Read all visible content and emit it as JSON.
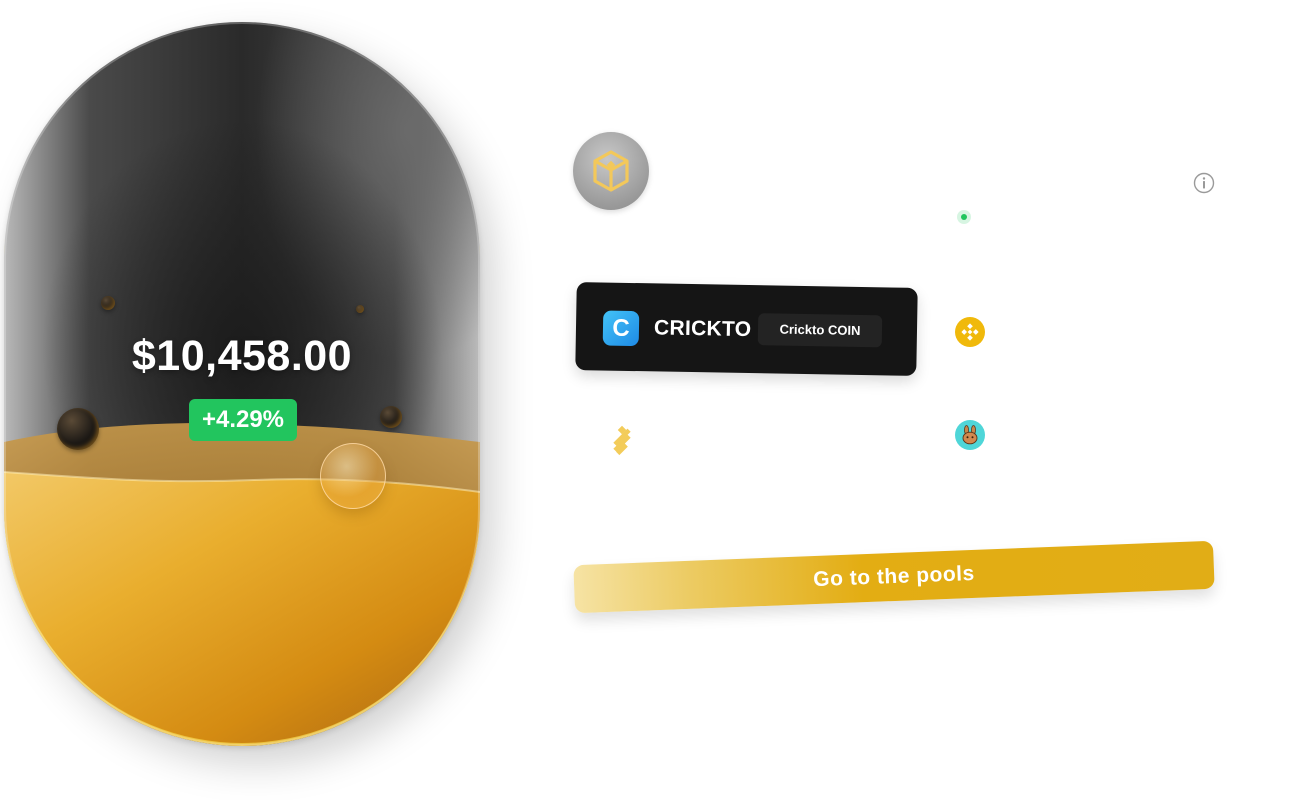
{
  "wallet": {
    "balance": "$10,458.00",
    "change": "+4.29%"
  },
  "token": {
    "logo_letter": "C",
    "name": "CRICKTO",
    "tag": "Crickto COIN"
  },
  "icons": {
    "network_logo": "bnb-cube-logo-icon",
    "info": "info-icon",
    "status": "online-status-dot-icon",
    "coin_1": "bnb-coin-icon",
    "coin_2": "pancakeswap-cake-icon",
    "coin_3": "busd-stablecoin-icon"
  },
  "actions": {
    "pools_label": "Go to the pools"
  },
  "colors": {
    "accent_gold": "#e1ad16",
    "positive_green": "#22c55e",
    "card_dark": "#151515",
    "token_blue": "#1e8ae6",
    "bnb_yellow": "#f0b90b",
    "cake_teal": "#4fd6d8"
  }
}
